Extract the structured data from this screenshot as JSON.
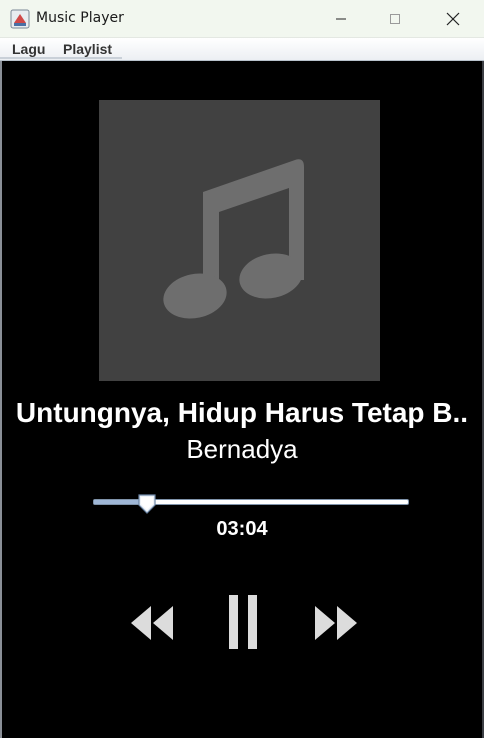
{
  "window": {
    "title": "Music Player",
    "controls": [
      "minimize",
      "maximize",
      "close"
    ]
  },
  "menu": {
    "items": [
      {
        "label": "Lagu"
      },
      {
        "label": "Playlist"
      }
    ]
  },
  "player": {
    "album_art_icon": "music-note-icon",
    "song_title": "Untungnya, Hidup Harus Tetap B..",
    "artist": "Bernadya",
    "progress_fraction": 0.17,
    "time": "03:04",
    "controls": {
      "previous_icon": "rewind-icon",
      "play_pause_icon": "pause-icon",
      "next_icon": "fast-forward-icon"
    }
  },
  "colors": {
    "background": "#000000",
    "album_art_bg": "#414141",
    "music_note": "#6e6e6e",
    "control_fill": "#dcdcdc",
    "text": "#ffffff"
  }
}
